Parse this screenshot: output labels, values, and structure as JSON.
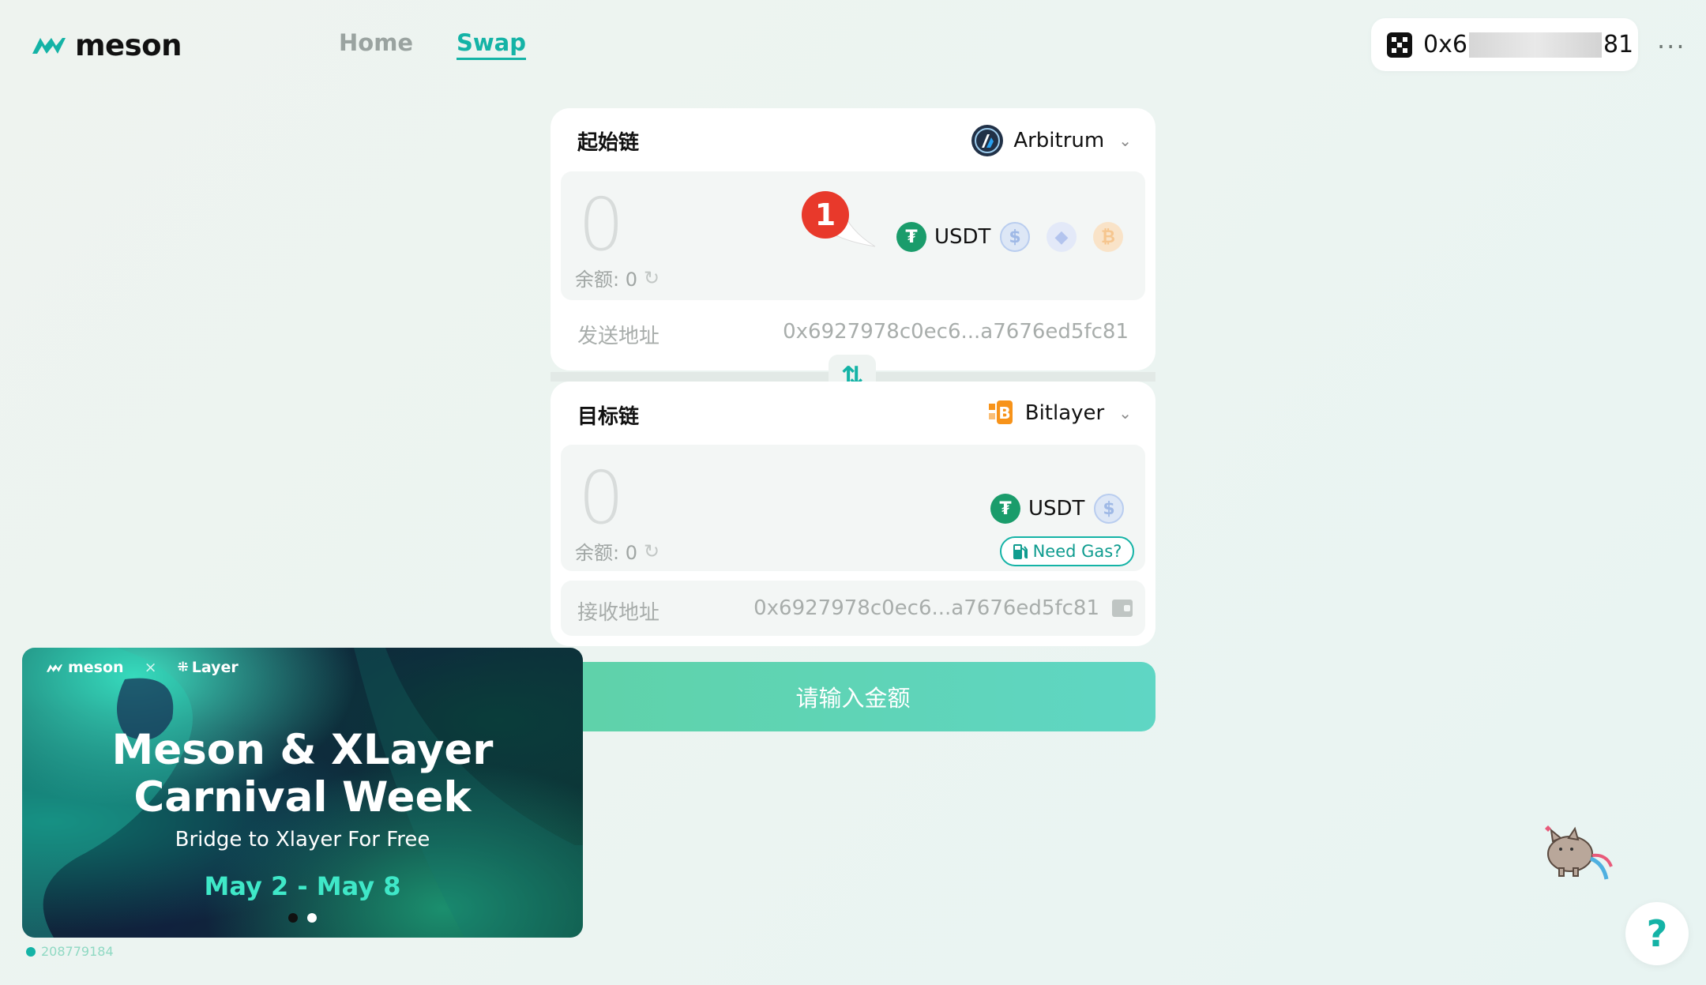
{
  "header": {
    "logo_text": "meson",
    "nav": {
      "home": "Home",
      "swap": "Swap"
    },
    "wallet": {
      "prefix": "0x6",
      "suffix": "81"
    },
    "more_label": "···"
  },
  "from": {
    "title": "起始链",
    "chain": "Arbitrum",
    "amount": "0",
    "balance_label": "余额: 0",
    "token": "USDT",
    "address_label": "发送地址",
    "address": "0x6927978c0ec6...a7676ed5fc81",
    "step_badge": "1"
  },
  "to": {
    "title": "目标链",
    "chain": "Bitlayer",
    "amount": "0",
    "balance_label": "余额: 0",
    "token": "USDT",
    "need_gas": "Need Gas?",
    "address_label": "接收地址",
    "address": "0x6927978c0ec6...a7676ed5fc81"
  },
  "submit_label": "请输入金额",
  "banner": {
    "brand_left": "meson",
    "brand_sep": "×",
    "brand_right": "Layer",
    "title_line1": "Meson & XLayer",
    "title_line2": "Carnival Week",
    "subtitle": "Bridge to Xlayer For Free",
    "dates": "May 2 - May 8"
  },
  "block_number": "208779184",
  "help_label": "?",
  "colors": {
    "accent": "#14b3a6",
    "usdt": "#1a9c6b",
    "usdc": "#9fb9e6",
    "eth": "#b3c4ee",
    "btc": "#f6c68f"
  }
}
